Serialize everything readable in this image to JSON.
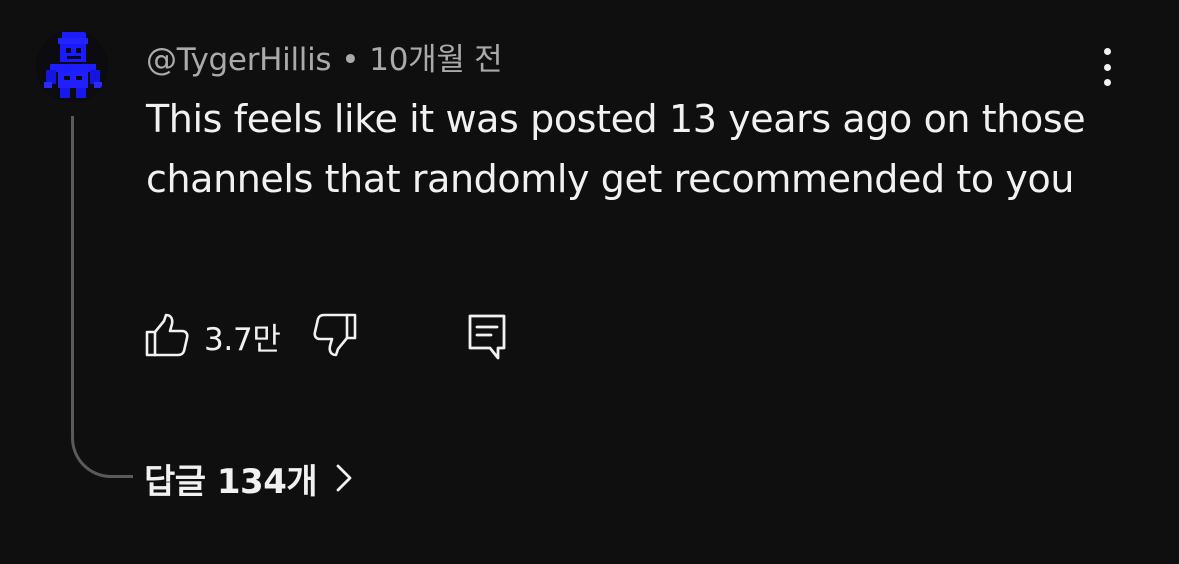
{
  "comment": {
    "author": "@TygerHillis",
    "separator": "•",
    "time": "10개월 전",
    "text": "This feels like it was posted 13 years ago on those channels that randomly get recommended to you",
    "like_count": "3.7만"
  },
  "replies": {
    "label": "답글 134개"
  },
  "icons": {
    "avatar": "blue-pixel-figure-avatar",
    "menu": "more-vert-icon",
    "like": "thumbs-up-icon",
    "dislike": "thumbs-down-icon",
    "reply": "comment-icon",
    "chevron": "chevron-right-icon"
  },
  "colors": {
    "background": "#0f0f0f",
    "text_primary": "#f1f1f1",
    "text_secondary": "#aaaaaa",
    "thread_line": "#5a5a5a",
    "avatar_accent": "#1c1cff"
  }
}
